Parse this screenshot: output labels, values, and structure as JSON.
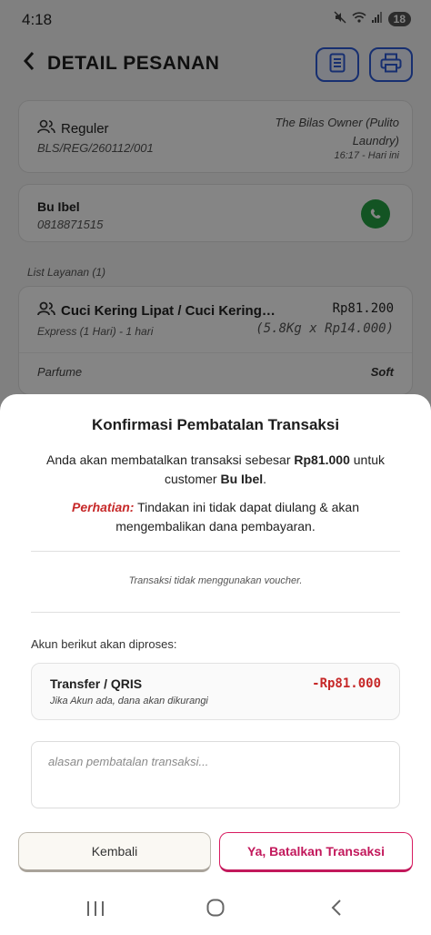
{
  "status_bar": {
    "time": "4:18",
    "battery": "18"
  },
  "header": {
    "title": "DETAIL PESANAN",
    "back_icon": "chevron-left-icon",
    "receipt_icon": "document-icon",
    "print_icon": "printer-icon"
  },
  "order": {
    "service": "Reguler",
    "order_number": "BLS/REG/260112/001",
    "owner": "The Bilas Owner (Pulito Laundry)",
    "time": "16:17 - Hari ini"
  },
  "customer": {
    "name": "Bu Ibel",
    "phone": "0818871515",
    "whatsapp_icon": "whatsapp-icon"
  },
  "services": {
    "label": "List Layanan (1)",
    "items": [
      {
        "name": "Cuci Kering Lipat / Cuci Kering…",
        "price": "Rp81.200",
        "subtitle": "Express (1 Hari) - 1 hari",
        "calc": "(5.8Kg x Rp14.000)",
        "parfum_label": "Parfume",
        "parfum_value": "Soft"
      }
    ]
  },
  "dialog": {
    "title": "Konfirmasi Pembatalan Transaksi",
    "msg_prefix": "Anda akan membatalkan transaksi sebesar ",
    "msg_amount": "Rp81.000",
    "msg_mid": " untuk customer ",
    "msg_customer": "Bu Ibel",
    "msg_suffix": ".",
    "warn_label": "Perhatian:",
    "warn_text": " Tindakan ini tidak dapat diulang & akan mengembalikan dana pembayaran.",
    "voucher_note": "Transaksi tidak menggunakan voucher.",
    "accounts_label": "Akun berikut akan diproses:",
    "account": {
      "name": "Transfer / QRIS",
      "note": "Jika Akun ada, dana akan dikurangi",
      "amount": "-Rp81.000"
    },
    "reason_placeholder": "alasan pembatalan transaksi...",
    "back_button": "Kembali",
    "confirm_button": "Ya, Batalkan Transaksi"
  },
  "colors": {
    "accent": "#2d5bd7",
    "danger": "#c62828",
    "confirm": "#c2185b",
    "whatsapp": "#25a244"
  }
}
